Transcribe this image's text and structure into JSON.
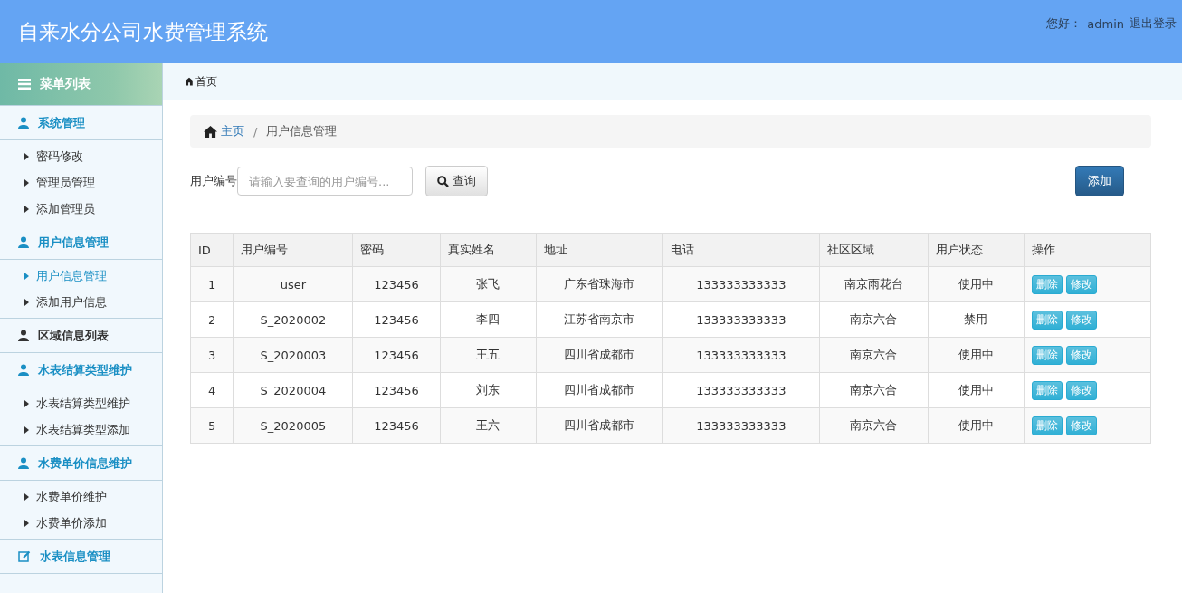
{
  "header": {
    "title": "自来水分公司水费管理系统",
    "greeting": "您好：",
    "user": "admin",
    "logout": "退出登录"
  },
  "sidebar": {
    "title": "菜单列表",
    "groups": [
      {
        "label": "系统管理",
        "kind": "group",
        "children": [
          {
            "label": "密码修改",
            "selected": false
          },
          {
            "label": "管理员管理",
            "selected": false
          },
          {
            "label": "添加管理员",
            "selected": false
          }
        ]
      },
      {
        "label": "用户信息管理",
        "kind": "group",
        "children": [
          {
            "label": "用户信息管理",
            "selected": true
          },
          {
            "label": "添加用户信息",
            "selected": false
          }
        ]
      },
      {
        "label": "区域信息列表",
        "kind": "link"
      },
      {
        "label": "水表结算类型维护",
        "kind": "group",
        "children": [
          {
            "label": "水表结算类型维护",
            "selected": false
          },
          {
            "label": "水表结算类型添加",
            "selected": false
          }
        ]
      },
      {
        "label": "水费单价信息维护",
        "kind": "group",
        "children": [
          {
            "label": "水费单价维护",
            "selected": false
          },
          {
            "label": "水费单价添加",
            "selected": false
          }
        ]
      },
      {
        "label": "水表信息管理",
        "kind": "form"
      }
    ]
  },
  "topnav": {
    "home": "首页"
  },
  "breadcrumb": [
    {
      "label": "主页"
    },
    {
      "label": "用户信息管理"
    }
  ],
  "breadcrumb_separator": "/",
  "search": {
    "label": "用户编号",
    "placeholder": "请输入要查询的用户编号...",
    "button": "查询"
  },
  "add_button": "添加",
  "table": {
    "columns": [
      "ID",
      "用户编号",
      "密码",
      "真实姓名",
      "地址",
      "电话",
      "社区区域",
      "用户状态",
      "操作"
    ],
    "rows": [
      {
        "cells": [
          "1",
          "user",
          "123456",
          "张飞",
          "广东省珠海市",
          "133333333333",
          "南京雨花台",
          "使用中"
        ],
        "actions": [
          "删除",
          "修改"
        ]
      },
      {
        "cells": [
          "2",
          "S_2020002",
          "123456",
          "李四",
          "江苏省南京市",
          "133333333333",
          "南京六合",
          "禁用"
        ],
        "actions": [
          "删除",
          "修改"
        ]
      },
      {
        "cells": [
          "3",
          "S_2020003",
          "123456",
          "王五",
          "四川省成都市",
          "133333333333",
          "南京六合",
          "使用中"
        ],
        "actions": [
          "删除",
          "修改"
        ]
      },
      {
        "cells": [
          "4",
          "S_2020004",
          "123456",
          "刘东",
          "四川省成都市",
          "133333333333",
          "南京六合",
          "使用中"
        ],
        "actions": [
          "删除",
          "修改"
        ]
      },
      {
        "cells": [
          "5",
          "S_2020005",
          "123456",
          "王六",
          "四川省成都市",
          "133333333333",
          "南京六合",
          "使用中"
        ],
        "actions": [
          "删除",
          "修改"
        ]
      }
    ]
  }
}
